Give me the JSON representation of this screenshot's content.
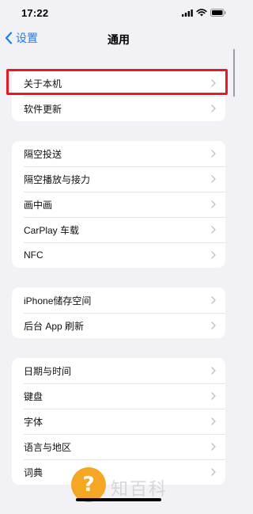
{
  "status_bar": {
    "time": "17:22",
    "icons": [
      "signal-icon",
      "wifi-icon",
      "battery-icon"
    ]
  },
  "nav": {
    "back_label": "设置",
    "title": "通用"
  },
  "groups": [
    {
      "items": [
        "关于本机",
        "软件更新"
      ]
    },
    {
      "items": [
        "隔空投送",
        "隔空播放与接力",
        "画中画",
        "CarPlay 车载",
        "NFC"
      ]
    },
    {
      "items": [
        "iPhone储存空间",
        "后台 App 刷新"
      ]
    },
    {
      "items": [
        "日期与时间",
        "键盘",
        "字体",
        "语言与地区",
        "词典"
      ]
    }
  ],
  "highlighted_item": "关于本机",
  "watermark": {
    "badge": "?",
    "text": "知百科"
  },
  "colors": {
    "background": "#f2f2f6",
    "accent": "#147efb",
    "highlight": "#e51b24",
    "watermark": "#f5a623"
  }
}
